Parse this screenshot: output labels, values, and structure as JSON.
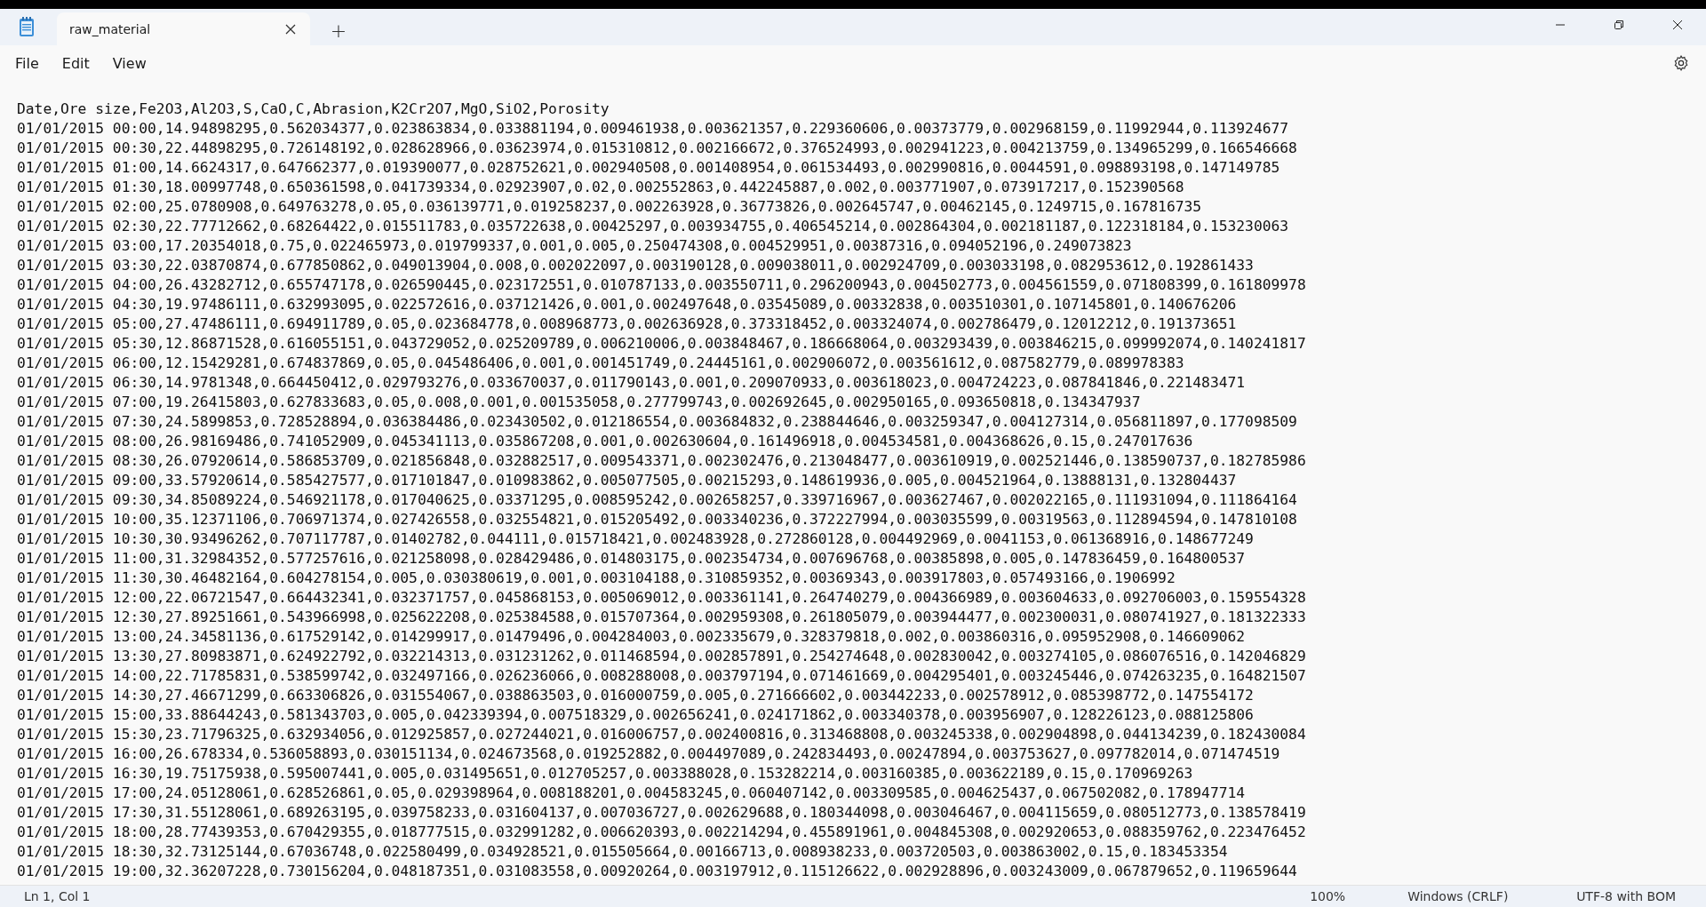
{
  "window": {
    "tab_title": "raw_material",
    "new_tab": "+"
  },
  "menu": [
    "File",
    "Edit",
    "View"
  ],
  "lines": [
    "Date,Ore size,Fe2O3,Al2O3,S,CaO,C,Abrasion,K2Cr2O7,MgO,SiO2,Porosity",
    "01/01/2015 00:00,14.94898295,0.562034377,0.023863834,0.033881194,0.009461938,0.003621357,0.229360606,0.00373779,0.002968159,0.11992944,0.113924677",
    "01/01/2015 00:30,22.44898295,0.726148192,0.028628966,0.03623974,0.015310812,0.002166672,0.376524993,0.002941223,0.004213759,0.134965299,0.166546668",
    "01/01/2015 01:00,14.6624317,0.647662377,0.019390077,0.028752621,0.002940508,0.001408954,0.061534493,0.002990816,0.0044591,0.098893198,0.147149785",
    "01/01/2015 01:30,18.00997748,0.650361598,0.041739334,0.02923907,0.02,0.002552863,0.442245887,0.002,0.003771907,0.073917217,0.152390568",
    "01/01/2015 02:00,25.0780908,0.649763278,0.05,0.036139771,0.019258237,0.002263928,0.36773826,0.002645747,0.00462145,0.1249715,0.167816735",
    "01/01/2015 02:30,22.77712662,0.68264422,0.015511783,0.035722638,0.00425297,0.003934755,0.406545214,0.002864304,0.002181187,0.122318184,0.153230063",
    "01/01/2015 03:00,17.20354018,0.75,0.022465973,0.019799337,0.001,0.005,0.250474308,0.004529951,0.00387316,0.094052196,0.249073823",
    "01/01/2015 03:30,22.03870874,0.677850862,0.049013904,0.008,0.002022097,0.003190128,0.009038011,0.002924709,0.003033198,0.082953612,0.192861433",
    "01/01/2015 04:00,26.43282712,0.655747178,0.026590445,0.023172551,0.010787133,0.003550711,0.296200943,0.004502773,0.004561559,0.071808399,0.161809978",
    "01/01/2015 04:30,19.97486111,0.632993095,0.022572616,0.037121426,0.001,0.002497648,0.03545089,0.00332838,0.003510301,0.107145801,0.140676206",
    "01/01/2015 05:00,27.47486111,0.694911789,0.05,0.023684778,0.008968773,0.002636928,0.373318452,0.003324074,0.002786479,0.12012212,0.191373651",
    "01/01/2015 05:30,12.86871528,0.616055151,0.043729052,0.025209789,0.006210006,0.003848467,0.186668064,0.003293439,0.003846215,0.099992074,0.140241817",
    "01/01/2015 06:00,12.15429281,0.674837869,0.05,0.045486406,0.001,0.001451749,0.24445161,0.002906072,0.003561612,0.087582779,0.089978383",
    "01/01/2015 06:30,14.9781348,0.664450412,0.029793276,0.033670037,0.011790143,0.001,0.209070933,0.003618023,0.004724223,0.087841846,0.221483471",
    "01/01/2015 07:00,19.26415803,0.627833683,0.05,0.008,0.001,0.001535058,0.277799743,0.002692645,0.002950165,0.093650818,0.134347937",
    "01/01/2015 07:30,24.5899853,0.728528894,0.036384486,0.023430502,0.012186554,0.003684832,0.238844646,0.003259347,0.004127314,0.056811897,0.177098509",
    "01/01/2015 08:00,26.98169486,0.741052909,0.045341113,0.035867208,0.001,0.002630604,0.161496918,0.004534581,0.004368626,0.15,0.247017636",
    "01/01/2015 08:30,26.07920614,0.586853709,0.021856848,0.032882517,0.009543371,0.002302476,0.213048477,0.003610919,0.002521446,0.138590737,0.182785986",
    "01/01/2015 09:00,33.57920614,0.585427577,0.017101847,0.010983862,0.005077505,0.00215293,0.148619936,0.005,0.004521964,0.13888131,0.132804437",
    "01/01/2015 09:30,34.85089224,0.546921178,0.017040625,0.03371295,0.008595242,0.002658257,0.339716967,0.003627467,0.002022165,0.111931094,0.111864164",
    "01/01/2015 10:00,35.12371106,0.706971374,0.027426558,0.032554821,0.015205492,0.003340236,0.372227994,0.003035599,0.00319563,0.112894594,0.147810108",
    "01/01/2015 10:30,30.93496262,0.707117787,0.01402782,0.044111,0.015718421,0.002483928,0.272860128,0.004492969,0.0041153,0.061368916,0.148677249",
    "01/01/2015 11:00,31.32984352,0.577257616,0.021258098,0.028429486,0.014803175,0.002354734,0.007696768,0.00385898,0.005,0.147836459,0.164800537",
    "01/01/2015 11:30,30.46482164,0.604278154,0.005,0.030380619,0.001,0.003104188,0.310859352,0.00369343,0.003917803,0.057493166,0.1906992",
    "01/01/2015 12:00,22.06721547,0.664432341,0.032371757,0.045868153,0.005069012,0.003361141,0.264740279,0.004366989,0.003604633,0.092706003,0.159554328",
    "01/01/2015 12:30,27.89251661,0.543966998,0.025622208,0.025384588,0.015707364,0.002959308,0.261805079,0.003944477,0.002300031,0.080741927,0.181322333",
    "01/01/2015 13:00,24.34581136,0.617529142,0.014299917,0.01479496,0.004284003,0.002335679,0.328379818,0.002,0.003860316,0.095952908,0.146609062",
    "01/01/2015 13:30,27.80983871,0.624922792,0.032214313,0.031231262,0.011468594,0.002857891,0.254274648,0.002830042,0.003274105,0.086076516,0.142046829",
    "01/01/2015 14:00,22.71785831,0.538599742,0.032497166,0.026236066,0.008288008,0.003797194,0.071461669,0.004295401,0.003245446,0.074263235,0.164821507",
    "01/01/2015 14:30,27.46671299,0.663306826,0.031554067,0.038863503,0.016000759,0.005,0.271666602,0.003442233,0.002578912,0.085398772,0.147554172",
    "01/01/2015 15:00,33.88644243,0.581343703,0.005,0.042339394,0.007518329,0.002656241,0.024171862,0.003340378,0.003956907,0.128226123,0.088125806",
    "01/01/2015 15:30,23.71796325,0.632934056,0.012925857,0.027244021,0.016006757,0.002400816,0.313468808,0.003245338,0.002904898,0.044134239,0.182430084",
    "01/01/2015 16:00,26.678334,0.536058893,0.030151134,0.024673568,0.019252882,0.004497089,0.242834493,0.00247894,0.003753627,0.097782014,0.071474519",
    "01/01/2015 16:30,19.75175938,0.595007441,0.005,0.031495651,0.012705257,0.003388028,0.153282214,0.003160385,0.003622189,0.15,0.170969263",
    "01/01/2015 17:00,24.05128061,0.628526861,0.05,0.029398964,0.008188201,0.004583245,0.060407142,0.003309585,0.004625437,0.067502082,0.178947714",
    "01/01/2015 17:30,31.55128061,0.689263195,0.039758233,0.031604137,0.007036727,0.002629688,0.180344098,0.003046467,0.004115659,0.080512773,0.138578419",
    "01/01/2015 18:00,28.77439353,0.670429355,0.018777515,0.032991282,0.006620393,0.002214294,0.455891961,0.004845308,0.002920653,0.088359762,0.223476452",
    "01/01/2015 18:30,32.73125144,0.67036748,0.022580499,0.034928521,0.015505664,0.00166713,0.008938233,0.003720503,0.003863002,0.15,0.183453354",
    "01/01/2015 19:00,32.36207228,0.730156204,0.048187351,0.031083558,0.00920264,0.003197912,0.115126622,0.002928896,0.003243009,0.067879652,0.119659644"
  ],
  "status_bar": {
    "position": "Ln 1, Col 1",
    "zoom": "100%",
    "line_ending": "Windows (CRLF)",
    "encoding": "UTF-8 with BOM"
  }
}
